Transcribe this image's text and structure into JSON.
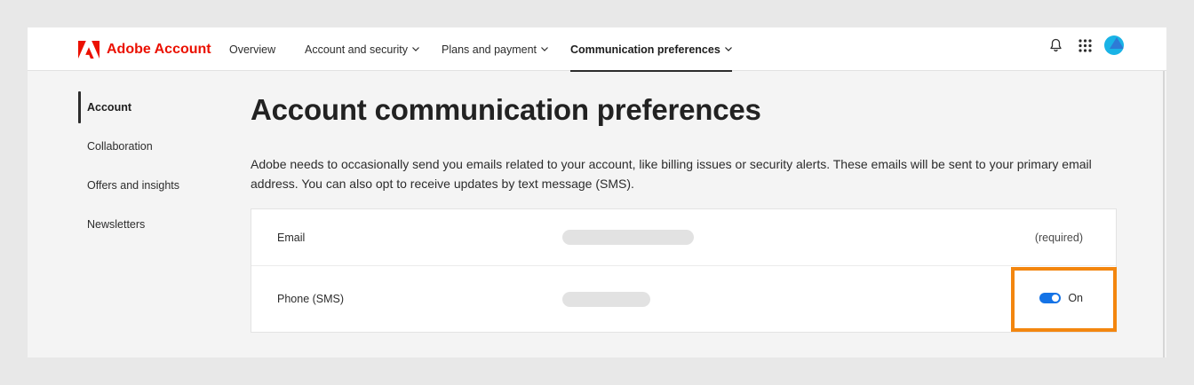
{
  "header": {
    "brand_name": "Adobe Account",
    "brand_color": "#eb1000",
    "nav": [
      {
        "label": "Overview",
        "has_chevron": false
      },
      {
        "label": "Account and security",
        "has_chevron": true
      },
      {
        "label": "Plans and payment",
        "has_chevron": true
      },
      {
        "label": "Communication preferences",
        "has_chevron": true,
        "active": true
      }
    ],
    "icons": [
      "bell-icon",
      "app-grid-icon",
      "avatar"
    ]
  },
  "sidebar": {
    "items": [
      {
        "label": "Account",
        "active": true
      },
      {
        "label": "Collaboration"
      },
      {
        "label": "Offers and insights"
      },
      {
        "label": "Newsletters"
      }
    ]
  },
  "main": {
    "title": "Account communication preferences",
    "description": "Adobe needs to occasionally send you emails related to your account, like billing issues or security alerts. These emails will be sent to your primary email address. You can also opt to receive updates by text message (SMS).",
    "rows": [
      {
        "label": "Email",
        "status": "(required)"
      },
      {
        "label": "Phone (SMS)",
        "toggle_label": "On",
        "toggle_on": true
      }
    ]
  },
  "colors": {
    "toggle_on": "#1473e6",
    "highlight": "#f3860f"
  }
}
